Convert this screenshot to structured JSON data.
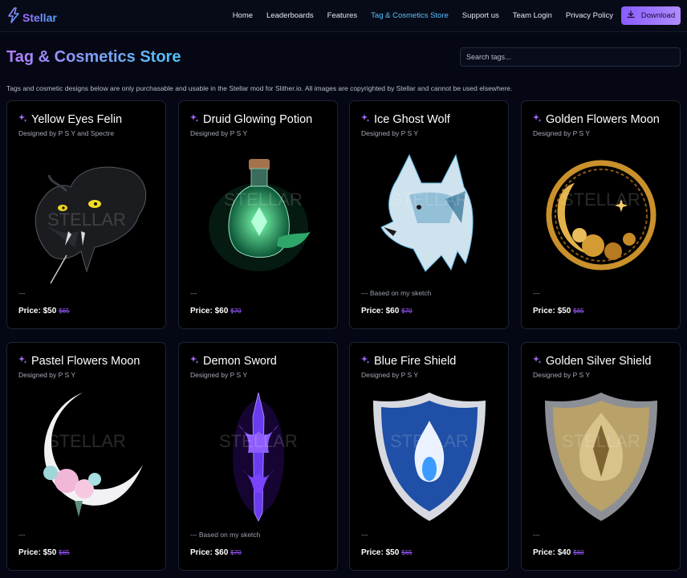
{
  "nav": {
    "brand": "Stellar",
    "links": [
      "Home",
      "Leaderboards",
      "Features",
      "Tag & Cosmetics Store",
      "Support us",
      "Team Login",
      "Privacy Policy"
    ],
    "active_index": 3,
    "download_label": "Download"
  },
  "page": {
    "title": "Tag & Cosmetics Store",
    "search_placeholder": "Search tags...",
    "notice": "Tags and cosmetic designs below are only purchasable and usable in the Stellar mod for Slither.io. All images are copyrighted by Stellar and cannot be used elsewhere."
  },
  "products": [
    {
      "name": "Yellow Eyes Felin",
      "designer": "Designed by P S Y and Spectre",
      "note": "---",
      "price": "Price: $50",
      "old_price": "$65",
      "art": "panther-art"
    },
    {
      "name": "Druid Glowing Potion",
      "designer": "Designed by P S Y",
      "note": "---",
      "price": "Price: $60",
      "old_price": "$70",
      "art": "potion-art"
    },
    {
      "name": "Ice Ghost Wolf",
      "designer": "Designed by P S Y",
      "note": "--- Based on my sketch",
      "price": "Price: $60",
      "old_price": "$70",
      "art": "wolf-art"
    },
    {
      "name": "Golden Flowers Moon",
      "designer": "Designed by P S Y",
      "note": "---",
      "price": "Price: $50",
      "old_price": "$65",
      "art": "golden-moon-art"
    },
    {
      "name": "Pastel Flowers Moon",
      "designer": "Designed by P S Y",
      "note": "---",
      "price": "Price: $50",
      "old_price": "$65",
      "art": "pastel-moon-art"
    },
    {
      "name": "Demon Sword",
      "designer": "Designed by P S Y",
      "note": "--- Based on my sketch",
      "price": "Price: $60",
      "old_price": "$70",
      "art": "sword-art"
    },
    {
      "name": "Blue Fire Shield",
      "designer": "Designed by P S Y",
      "note": "---",
      "price": "Price: $50",
      "old_price": "$65",
      "art": "blue-shield-art"
    },
    {
      "name": "Golden Silver Shield",
      "designer": "Designed by P S Y",
      "note": "---",
      "price": "Price: $40",
      "old_price": "$60",
      "art": "golden-shield-art"
    }
  ],
  "watermark": "STELLAR",
  "colors": {
    "background": "#050814",
    "accent_purple": "#8a5cff",
    "accent_cyan": "#59c2ff",
    "old_price": "#9a56ff"
  },
  "icons": {
    "brand": "stellar-logo-icon",
    "download": "download-icon",
    "sparkle": "sparkle-icon"
  }
}
